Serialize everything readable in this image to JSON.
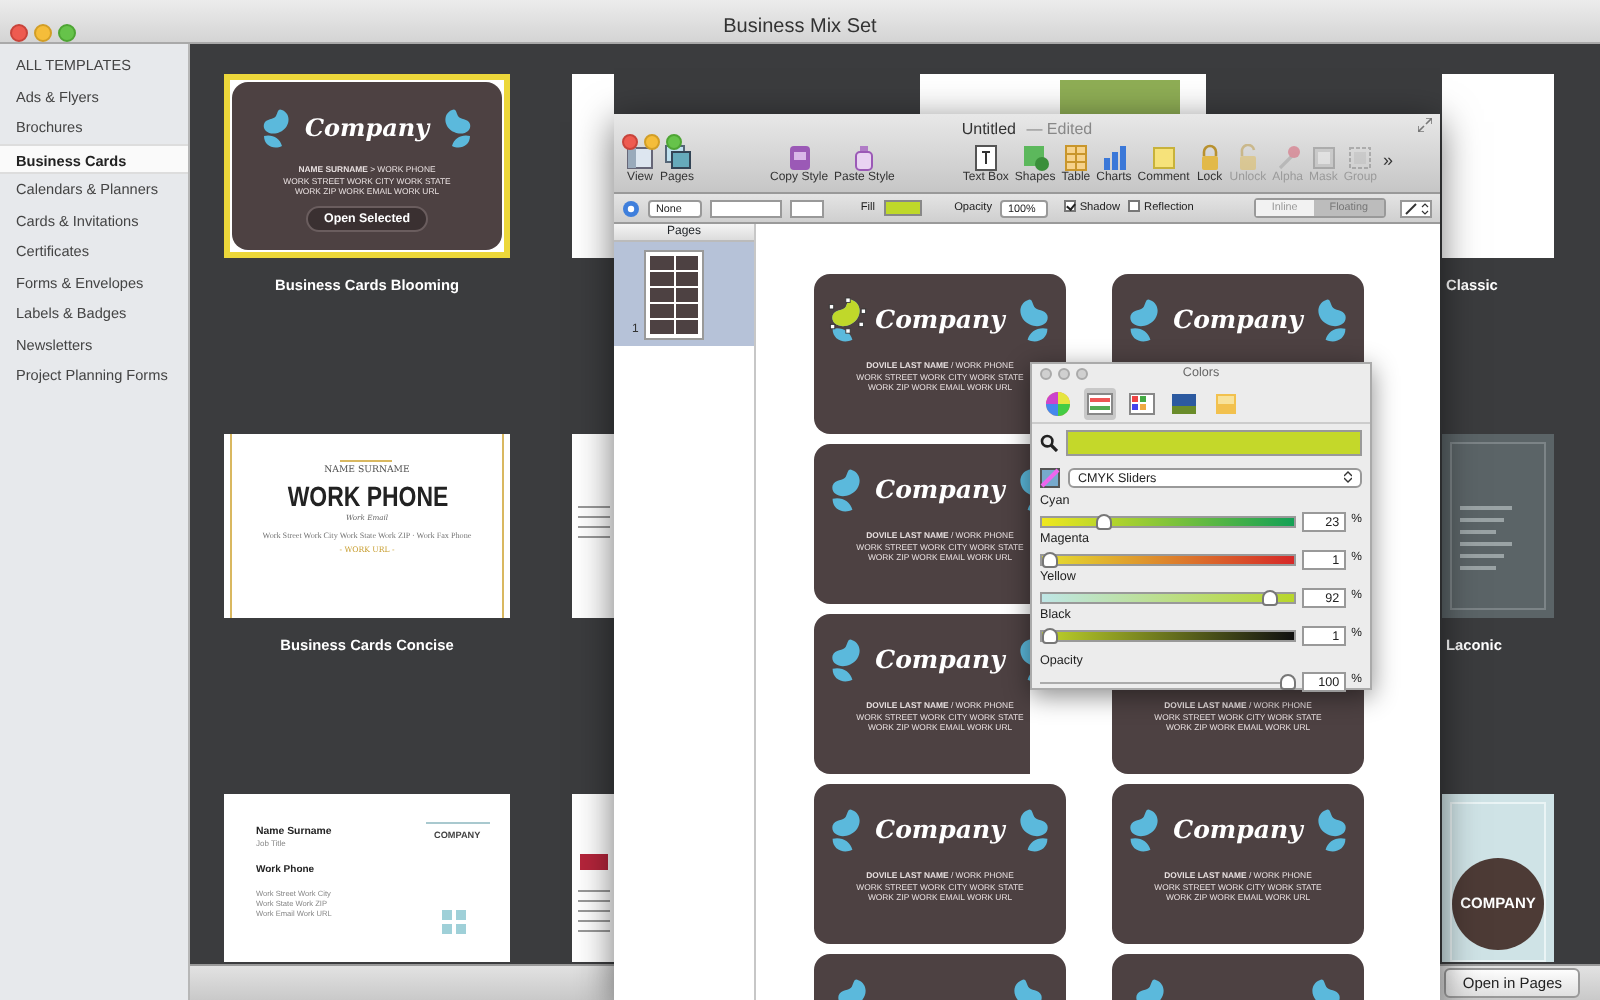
{
  "window": {
    "title": "Business Mix Set"
  },
  "sidebar": {
    "items": [
      {
        "label": "ALL TEMPLATES",
        "selected": false
      },
      {
        "label": "Ads & Flyers",
        "selected": false
      },
      {
        "label": "Brochures",
        "selected": false
      },
      {
        "label": "Business Cards",
        "selected": true
      },
      {
        "label": "Calendars & Planners",
        "selected": false
      },
      {
        "label": "Cards & Invitations",
        "selected": false
      },
      {
        "label": "Certificates",
        "selected": false
      },
      {
        "label": "Forms & Envelopes",
        "selected": false
      },
      {
        "label": "Labels & Badges",
        "selected": false
      },
      {
        "label": "Newsletters",
        "selected": false
      },
      {
        "label": "Project Planning Forms",
        "selected": false
      }
    ]
  },
  "templates": [
    {
      "kind": "blooming",
      "selected": true,
      "name": "Business Cards Blooming",
      "company": "Company",
      "lines": [
        "**NAME SURNAME** > WORK PHONE",
        "WORK STREET WORK CITY WORK STATE",
        "WORK ZIP WORK EMAIL WORK URL"
      ],
      "button": "Open Selected"
    },
    {
      "kind": "red-banner",
      "selected": false
    },
    {
      "kind": "green-banner",
      "selected": false
    },
    {
      "kind": "classic",
      "selected": false,
      "name": "Classic"
    },
    {
      "kind": "concise",
      "selected": false,
      "name": "Business Cards Concise",
      "lines": [
        "NAME SURNAME",
        "WORK PHONE",
        "Work Email",
        "Work Street Work City Work State Work ZIP · Work Fax Phone",
        "- WORK URL -"
      ]
    },
    {
      "kind": "grey-lines",
      "selected": false
    },
    {
      "kind": "covered"
    },
    {
      "kind": "laconic",
      "selected": false,
      "name": "Laconic"
    },
    {
      "kind": "contact",
      "selected": false,
      "lines": [
        "Name Surname",
        "Job Title",
        "Work Phone",
        "Work Street Work City",
        "Work State Work ZIP",
        "Work Email Work URL"
      ],
      "company": "COMPANY"
    },
    {
      "kind": "red-lines",
      "selected": false
    },
    {
      "kind": "covered"
    },
    {
      "kind": "circle",
      "selected": false,
      "company": "COMPANY"
    }
  ],
  "bottom_bar": {
    "button": "Open in Pages"
  },
  "pages_window": {
    "title": "Untitled",
    "status": "— Edited",
    "toolbar": {
      "groups": [
        [
          {
            "kind": "view",
            "label": "View",
            "disabled": false
          },
          {
            "kind": "pages",
            "label": "Pages",
            "disabled": false
          }
        ],
        [
          {
            "kind": "copy-style",
            "label": "Copy Style",
            "disabled": false
          },
          {
            "kind": "paste-style",
            "label": "Paste Style",
            "disabled": false
          }
        ],
        [
          {
            "kind": "text-box",
            "label": "Text Box",
            "disabled": false
          },
          {
            "kind": "shapes",
            "label": "Shapes",
            "disabled": false
          },
          {
            "kind": "table",
            "label": "Table",
            "disabled": false
          },
          {
            "kind": "charts",
            "label": "Charts",
            "disabled": false
          },
          {
            "kind": "comment",
            "label": "Comment",
            "disabled": false
          },
          {
            "kind": "lock",
            "label": "Lock",
            "disabled": false
          },
          {
            "kind": "unlock",
            "label": "Unlock",
            "disabled": true
          },
          {
            "kind": "alpha",
            "label": "Alpha",
            "disabled": true
          },
          {
            "kind": "mask",
            "label": "Mask",
            "disabled": true
          },
          {
            "kind": "group",
            "label": "Group",
            "disabled": true
          }
        ]
      ],
      "overflow": "»"
    },
    "format_bar": {
      "style": "None",
      "fill_label": "Fill",
      "opacity_label": "Opacity",
      "opacity": "100%",
      "options": [
        {
          "label": "Shadow",
          "checked": true
        },
        {
          "label": "Reflection",
          "checked": false
        }
      ],
      "wrap": [
        {
          "label": "Inline",
          "selected": false
        },
        {
          "label": "Floating",
          "selected": true
        }
      ]
    },
    "pages_panel": {
      "title": "Pages",
      "pages": [
        {
          "number": "1",
          "selected": true
        }
      ]
    },
    "cards": [
      {
        "kind": "blooming",
        "blob_selected": true,
        "company": "Company",
        "lines": [
          "**DOVILE LAST NAME** / WORK PHONE",
          "WORK STREET WORK CITY WORK STATE",
          "WORK ZIP WORK EMAIL WORK URL"
        ]
      },
      {
        "kind": "blooming",
        "blob_selected": false,
        "company": "Company"
      },
      {
        "kind": "blooming",
        "blob_selected": false,
        "company": "Company",
        "lines": [
          "**DOVILE LAST NAME** / WORK PHONE",
          "WORK STREET WORK CITY WORK STATE",
          "WORK ZIP WORK EMAIL WORK URL"
        ]
      },
      {
        "kind": "covered"
      },
      {
        "kind": "blooming",
        "blob_selected": false,
        "company": "Company",
        "lines": [
          "**DOVILE LAST NAME** / WORK PHONE",
          "WORK STREET WORK CITY WORK STATE",
          "WORK ZIP WORK EMAIL WORK URL"
        ]
      },
      {
        "kind": "blooming",
        "lines": [
          "**DOVILE LAST NAME** / WORK PHONE",
          "WORK STREET WORK CITY WORK STATE",
          "WORK ZIP WORK EMAIL WORK URL"
        ]
      },
      {
        "kind": "blooming",
        "blob_selected": false,
        "company": "Company",
        "lines": [
          "**DOVILE LAST NAME** / WORK PHONE",
          "WORK STREET WORK CITY WORK STATE",
          "WORK ZIP WORK EMAIL WORK URL"
        ]
      },
      {
        "kind": "blooming",
        "blob_selected": false,
        "company": "Company",
        "lines": [
          "**DOVILE LAST NAME** / WORK PHONE",
          "WORK STREET WORK CITY WORK STATE",
          "WORK ZIP WORK EMAIL WORK URL"
        ]
      },
      {
        "kind": "blooming",
        "blob_selected": false
      },
      {
        "kind": "blooming",
        "blob_selected": false
      }
    ]
  },
  "colors_panel": {
    "title": "Colors",
    "modes": [
      {
        "kind": "wheel",
        "selected": false
      },
      {
        "kind": "sliders",
        "selected": true
      },
      {
        "kind": "palettes",
        "selected": false
      },
      {
        "kind": "image",
        "selected": false
      },
      {
        "kind": "pencils",
        "selected": false
      }
    ],
    "model": "CMYK Sliders",
    "sliders": [
      {
        "kind": "cyan",
        "label": "Cyan",
        "level": 0.23,
        "value": "23",
        "unit": "%"
      },
      {
        "kind": "magenta",
        "label": "Magenta",
        "level": 0.01,
        "value": "1",
        "unit": "%"
      },
      {
        "kind": "yellow",
        "label": "Yellow",
        "level": 0.92,
        "value": "92",
        "unit": "%"
      },
      {
        "kind": "black",
        "label": "Black",
        "level": 0.01,
        "value": "1",
        "unit": "%"
      },
      {
        "kind": "opacity",
        "label": "Opacity",
        "level": 1,
        "value": "100",
        "unit": "%"
      }
    ]
  }
}
